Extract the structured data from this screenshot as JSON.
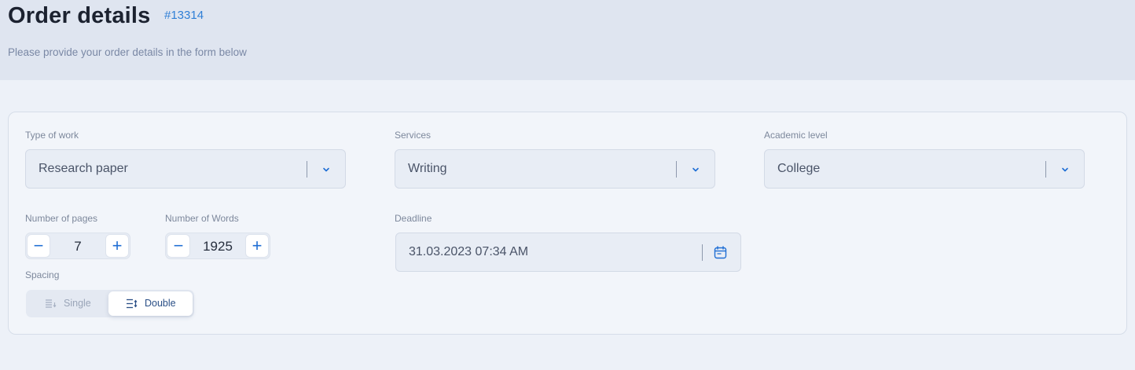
{
  "header": {
    "title": "Order details",
    "order_number": "#13314",
    "subtitle": "Please provide your order details in the form below"
  },
  "form": {
    "type_of_work": {
      "label": "Type of work",
      "value": "Research paper"
    },
    "services": {
      "label": "Services",
      "value": "Writing"
    },
    "academic_level": {
      "label": "Academic level",
      "value": "College"
    },
    "pages": {
      "label": "Number of pages",
      "value": "7",
      "minus": "−",
      "plus": "+"
    },
    "words": {
      "label": "Number of Words",
      "value": "1925",
      "minus": "−",
      "plus": "+"
    },
    "deadline": {
      "label": "Deadline",
      "value": "31.03.2023 07:34 AM"
    },
    "spacing": {
      "label": "Spacing",
      "options": [
        "Single",
        "Double"
      ],
      "selected": "Double"
    }
  },
  "colors": {
    "accent": "#1f6ed4",
    "order_number": "#2f7fd6",
    "header_bg": "#dfe5f0",
    "page_bg": "#edf1f8"
  },
  "icons": {
    "dropdown": "chevron-down-icon",
    "calendar": "calendar-icon",
    "single_spacing": "single-spacing-icon",
    "double_spacing": "double-spacing-icon"
  }
}
